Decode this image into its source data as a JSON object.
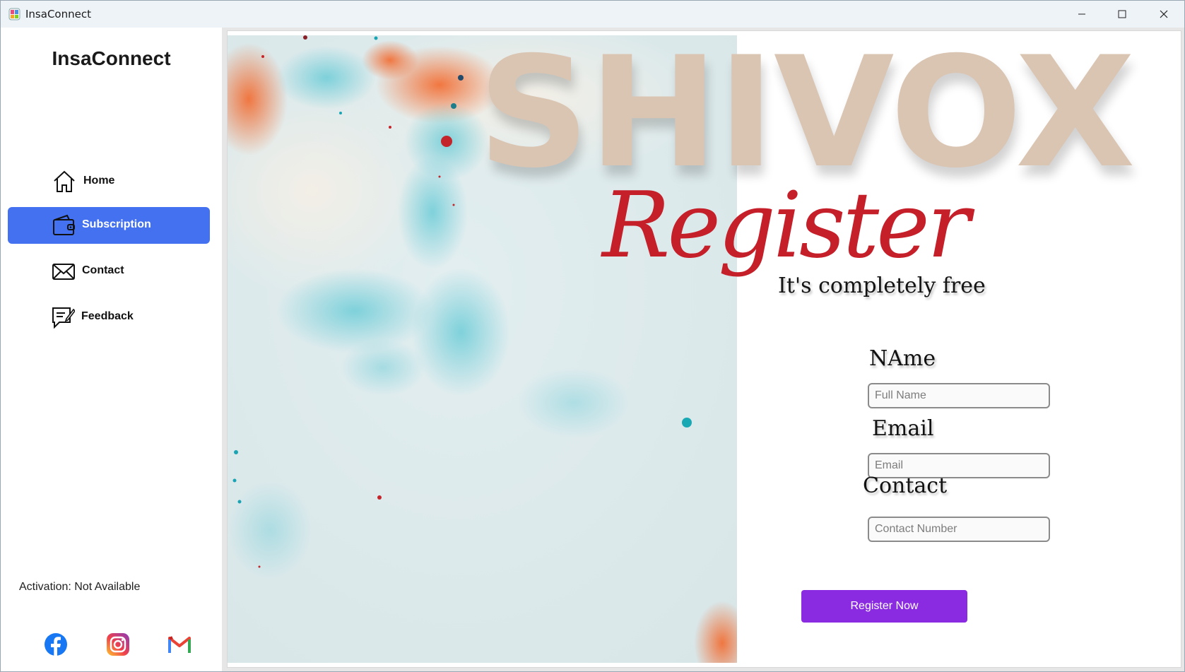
{
  "window": {
    "title": "InsaConnect"
  },
  "sidebar": {
    "brand": "InsaConnect",
    "items": [
      {
        "label": "Home",
        "icon": "home-icon",
        "active": false
      },
      {
        "label": "Subscription",
        "icon": "wallet-icon",
        "active": true
      },
      {
        "label": "Contact",
        "icon": "mail-icon",
        "active": false
      },
      {
        "label": "Feedback",
        "icon": "feedback-icon",
        "active": false
      }
    ],
    "activation": "Activation: Not Available",
    "social": [
      "facebook-icon",
      "instagram-icon",
      "gmail-icon"
    ]
  },
  "hero": {
    "brand_watermark": "SHIVOX",
    "heading": "Register",
    "subheading": "It's completely free"
  },
  "form": {
    "name_label": "NAme",
    "name_placeholder": "Full Name",
    "email_label": "Email",
    "email_placeholder": "Email",
    "contact_label": "Contact",
    "contact_placeholder": "Contact Number",
    "submit_label": "Register Now"
  },
  "colors": {
    "accent_nav": "#4471f0",
    "register_button": "#8a2be2",
    "register_script": "#c51f2a",
    "watermark": "#dac4b2"
  }
}
